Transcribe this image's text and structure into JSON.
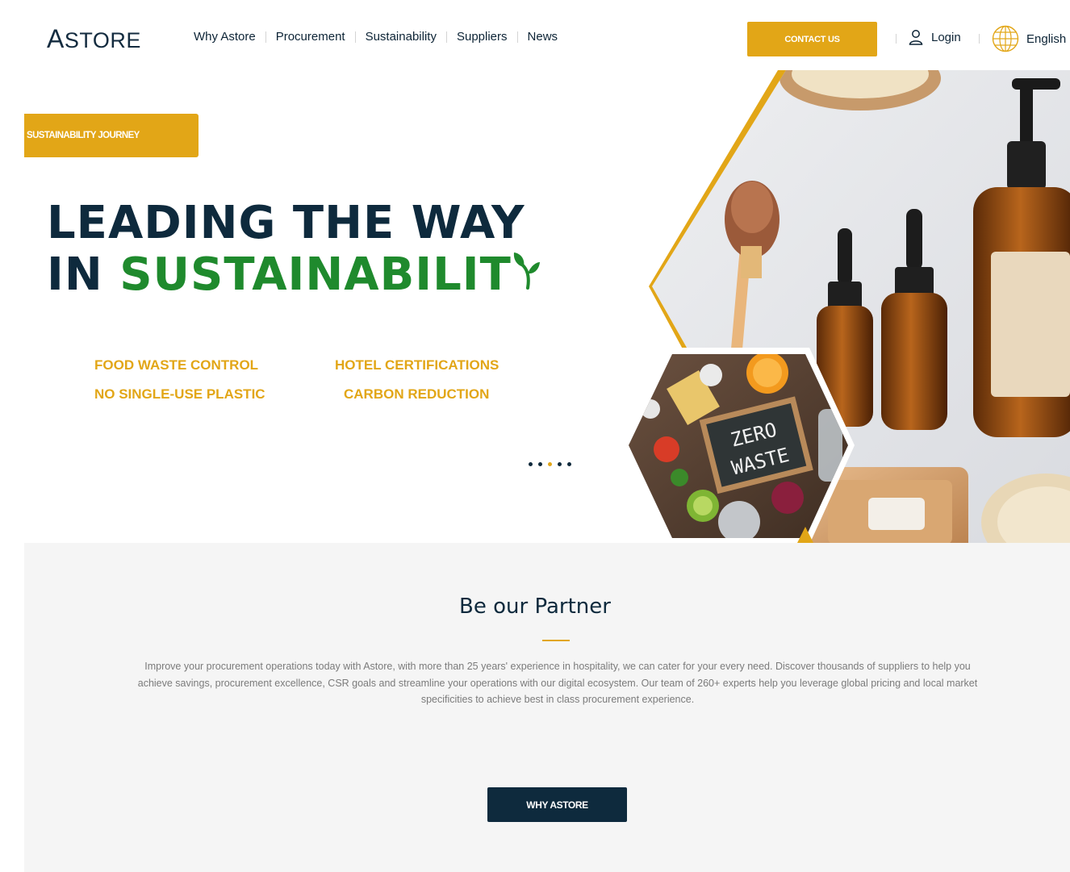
{
  "header": {
    "logo": "ASTORE",
    "nav": [
      "Why Astore",
      "Procurement",
      "Sustainability",
      "Suppliers",
      "News"
    ],
    "contact_label": "CONTACT US",
    "login_label": "Login",
    "language_label": "English"
  },
  "hero": {
    "badge": "SUSTAINABILITY JOURNEY",
    "headline_line1": "LEADING THE WAY",
    "headline_line2_prefix": "IN ",
    "headline_line2_green": "SUSTAINABILIT",
    "features": [
      "FOOD WASTE CONTROL",
      "HOTEL CERTIFICATIONS",
      "NO SINGLE-USE PLASTIC",
      "CARBON REDUCTION"
    ],
    "slider_dots": 5,
    "active_dot": 3,
    "chalkboard_line1": "ZERO",
    "chalkboard_line2": "WASTE"
  },
  "partner": {
    "title": "Be our Partner",
    "text": "Improve your procurement operations today with Astore, with more than 25 years' experience in hospitality, we can cater for your every need. Discover thousands of suppliers to help you achieve savings, procurement excellence, CSR goals and streamline your operations with our digital ecosystem. Our team of 260+ experts help you leverage global pricing and local market specificities to achieve best in class procurement experience.",
    "button_label": "WHY ASTORE"
  },
  "colors": {
    "accent": "#e2a617",
    "navy": "#0e2a3d",
    "green": "#1f8a2d",
    "section_bg": "#f5f5f5"
  },
  "icons": [
    "user-icon",
    "globe-icon",
    "sprout-icon"
  ]
}
